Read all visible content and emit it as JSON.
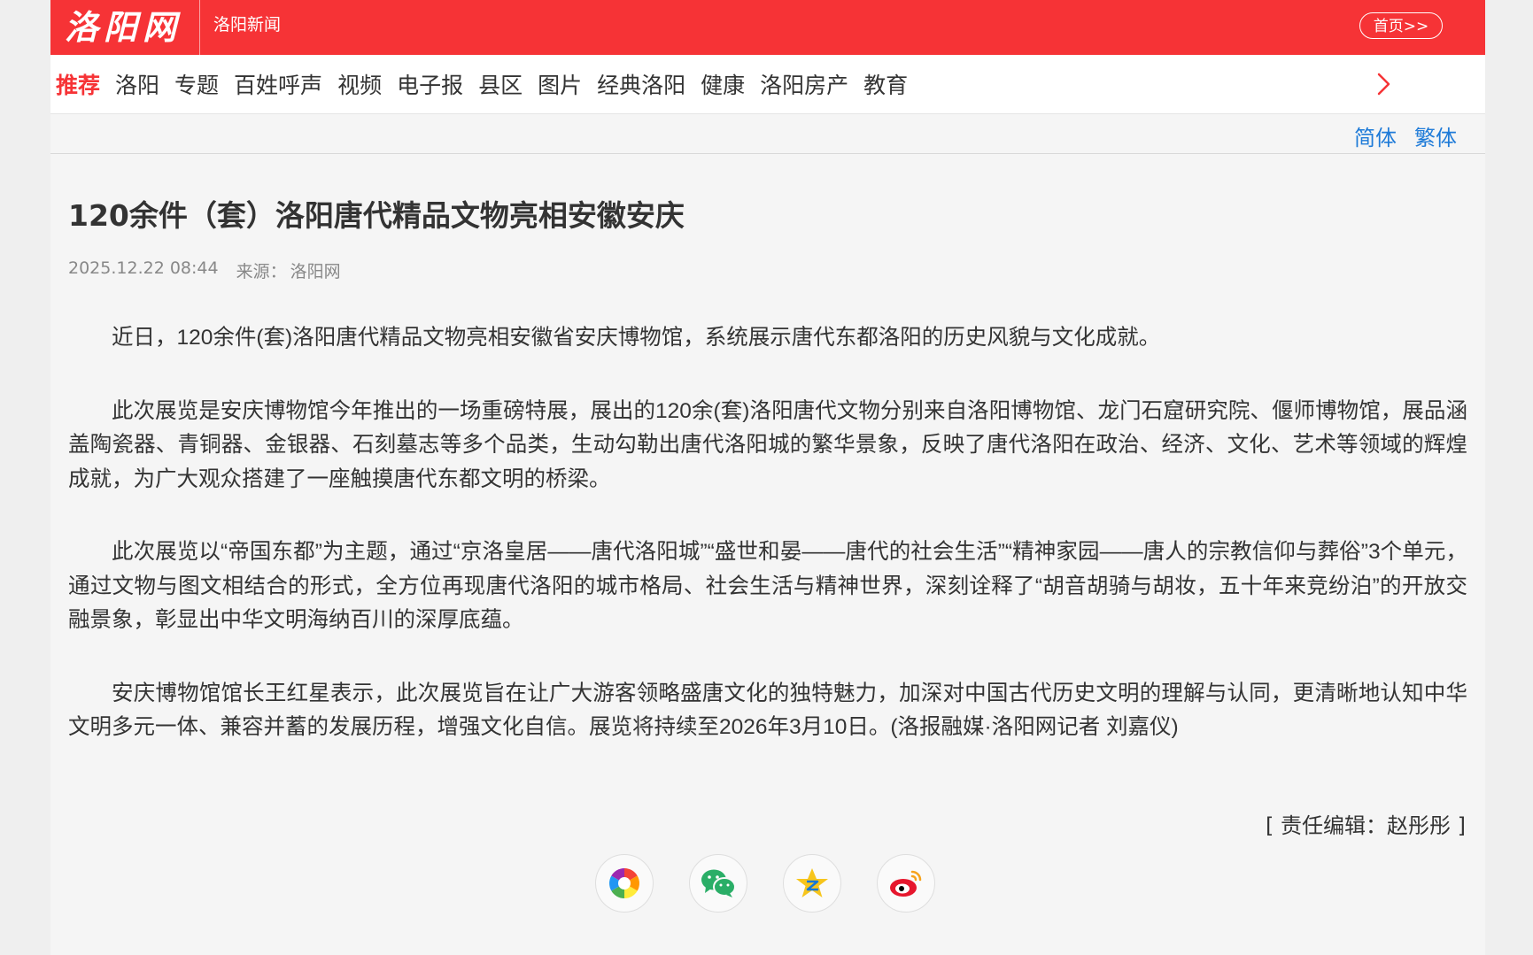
{
  "header": {
    "logo_text": "洛阳网",
    "section_title": "洛阳新闻",
    "home_label": "首页>>"
  },
  "nav": {
    "items": [
      {
        "label": "推荐",
        "active": true
      },
      {
        "label": "洛阳"
      },
      {
        "label": "专题"
      },
      {
        "label": "百姓呼声"
      },
      {
        "label": "视频"
      },
      {
        "label": "电子报"
      },
      {
        "label": "县区"
      },
      {
        "label": "图片"
      },
      {
        "label": "经典洛阳"
      },
      {
        "label": "健康"
      },
      {
        "label": "洛阳房产"
      },
      {
        "label": "教育"
      }
    ],
    "more_icon": "chevron-right-icon"
  },
  "lang": {
    "simplified": "简体",
    "traditional": "繁体"
  },
  "article": {
    "title": "120余件（套）洛阳唐代精品文物亮相安徽安庆",
    "date": "2025.12.22 08:44",
    "source_label": "来源：",
    "source": "洛阳网",
    "paragraphs": [
      "近日，120余件(套)洛阳唐代精品文物亮相安徽省安庆博物馆，系统展示唐代东都洛阳的历史风貌与文化成就。",
      "此次展览是安庆博物馆今年推出的一场重磅特展，展出的120余(套)洛阳唐代文物分别来自洛阳博物馆、龙门石窟研究院、偃师博物馆，展品涵盖陶瓷器、青铜器、金银器、石刻墓志等多个品类，生动勾勒出唐代洛阳城的繁华景象，反映了唐代洛阳在政治、经济、文化、艺术等领域的辉煌成就，为广大观众搭建了一座触摸唐代东都文明的桥梁。",
      "此次展览以“帝国东都”为主题，通过“京洛皇居——唐代洛阳城”“盛世和晏——唐代的社会生活”“精神家园——唐人的宗教信仰与葬俗”3个单元，通过文物与图文相结合的形式，全方位再现唐代洛阳的城市格局、社会生活与精神世界，深刻诠释了“胡音胡骑与胡妆，五十年来竞纷泊”的开放交融景象，彰显出中华文明海纳百川的深厚底蕴。",
      "安庆博物馆馆长王红星表示，此次展览旨在让广大游客领略盛唐文化的独特魅力，加深对中国古代历史文明的理解与认同，更清晰地认知中华文明多元一体、兼容并蓄的发展历程，增强文化自信。展览将持续至2026年3月10日。(洛报融媒·洛阳网记者 刘嘉仪)"
    ],
    "editor": "[ 责任编辑：赵彤彤 ]"
  },
  "share": {
    "icons": [
      "aperture-share-icon",
      "wechat-icon",
      "qzone-icon",
      "weibo-icon"
    ]
  },
  "colors": {
    "brand_red": "#f63336",
    "link_blue": "#1f7bd8"
  }
}
